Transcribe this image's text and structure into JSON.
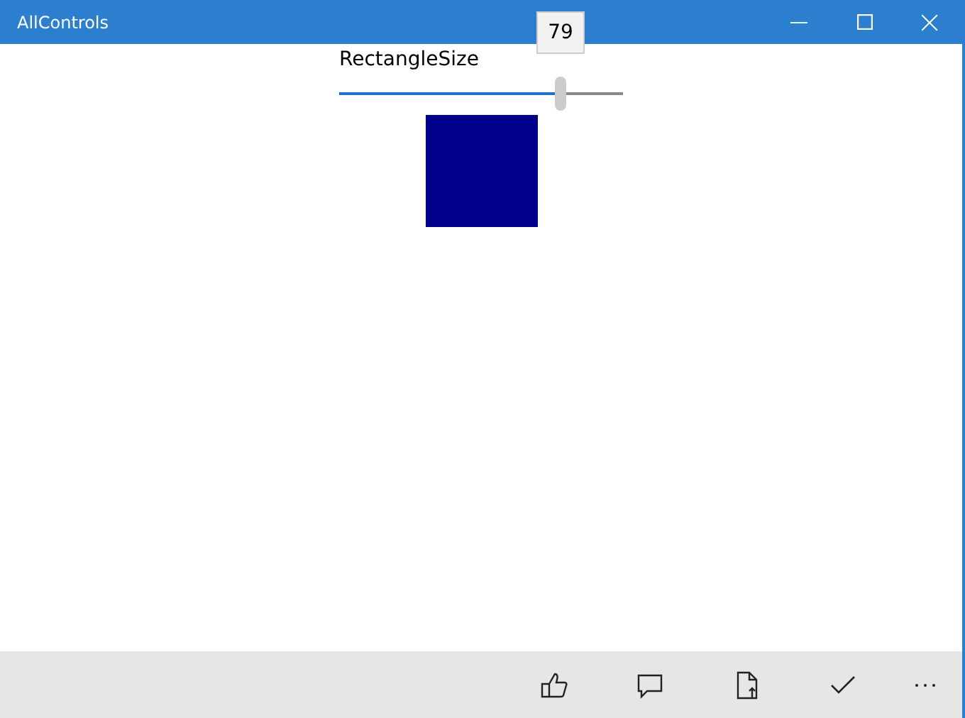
{
  "window": {
    "title": "AllControls"
  },
  "slider": {
    "label": "RectangleSize",
    "level": 0.78,
    "tooltip": "79"
  },
  "app_bar": {
    "buttons": [
      {
        "kind": "like"
      },
      {
        "kind": "comment"
      },
      {
        "kind": "upload"
      },
      {
        "kind": "accept"
      },
      {
        "kind": "more"
      }
    ]
  }
}
